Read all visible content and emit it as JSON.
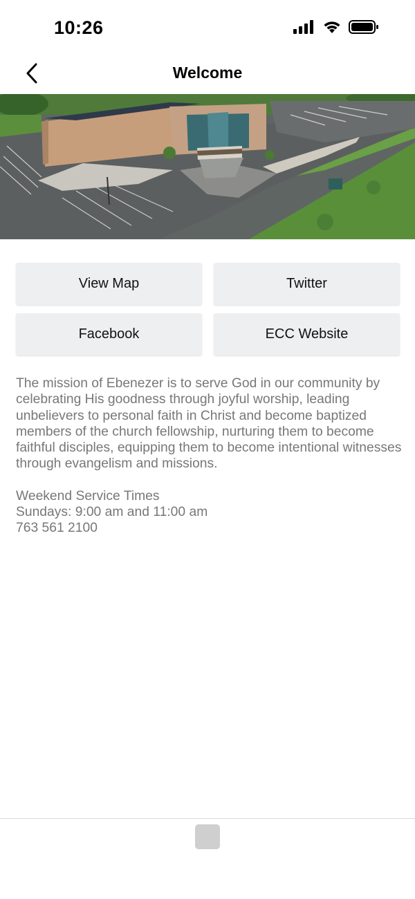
{
  "status_bar": {
    "time": "10:26",
    "icons": [
      "cellular-signal-icon",
      "wifi-icon",
      "battery-icon"
    ]
  },
  "nav": {
    "title": "Welcome",
    "back_icon": "chevron-left-icon"
  },
  "hero": {
    "alt": "Aerial photo of church building and parking lot"
  },
  "buttons": {
    "view_map": "View Map",
    "twitter": "Twitter",
    "facebook": "Facebook",
    "ecc_website": "ECC Website"
  },
  "content": {
    "mission": "The mission of Ebenezer is to serve God in our community by celebrating His goodness through joyful worship, leading unbelievers to personal faith in Christ and become baptized members of the church fellowship, nurturing them to become faithful disciples, equipping them to become intentional witnesses through evangelism and missions.",
    "service_heading": "Weekend Service Times",
    "service_times": "Sundays: 9:00 am and 11:00 am",
    "phone": "763 561 2100"
  },
  "colors": {
    "button_bg": "#eeeff1",
    "body_text": "#777777",
    "tab_placeholder": "#cfcfcf"
  }
}
